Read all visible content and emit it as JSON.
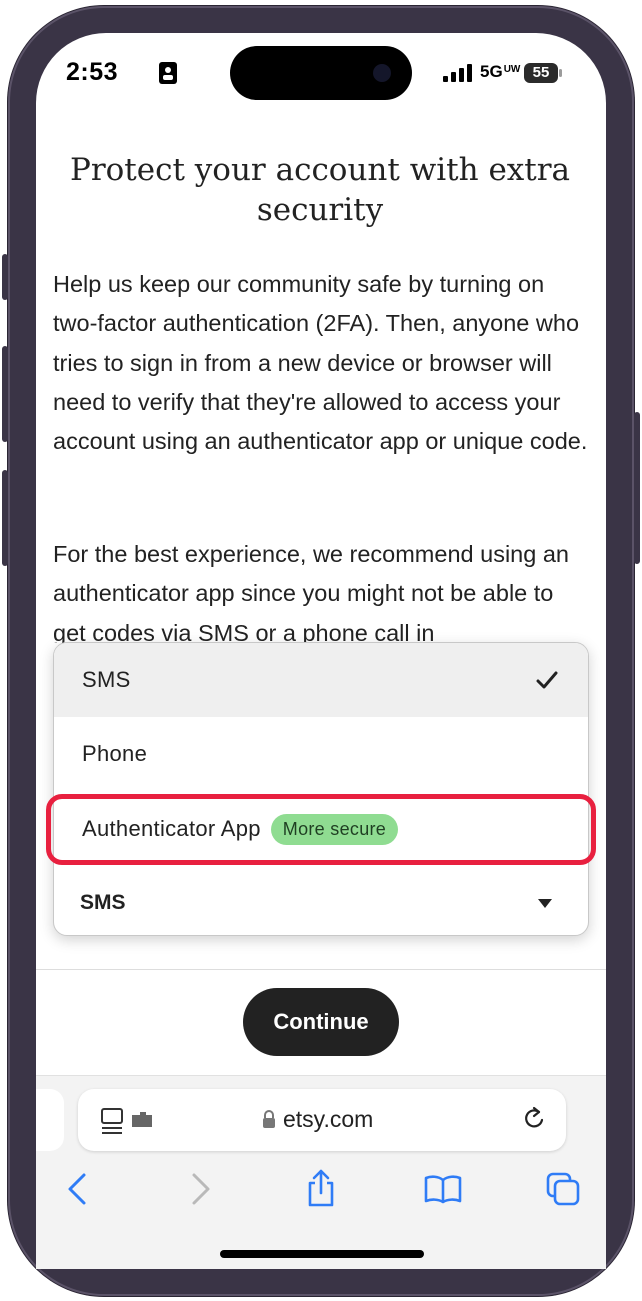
{
  "status_bar": {
    "time": "2:53",
    "network": "5G",
    "network_sup": "UW",
    "battery": "55"
  },
  "page": {
    "title": "Protect your account with extra security",
    "paragraph1": "Help us keep our community safe by turning on two-factor authentication (2FA). Then, anyone who tries to sign in from a new device or browser will need to verify that they're allowed to access your account using an authenticator app or unique code.",
    "paragraph2": "For the best experience, we recommend using an authenticator app since you might not be able to get codes via SMS or a phone call in"
  },
  "dropdown": {
    "options": [
      {
        "label": "SMS",
        "selected": true
      },
      {
        "label": "Phone",
        "selected": false
      },
      {
        "label": "Authenticator App",
        "badge": "More secure",
        "selected": false
      }
    ],
    "current_value": "SMS"
  },
  "continue_label": "Continue",
  "browser": {
    "url": "etsy.com"
  },
  "colors": {
    "highlight": "#e8203f",
    "badge": "#8fdc91",
    "safari_blue": "#2f7cf6",
    "button": "#222222"
  }
}
